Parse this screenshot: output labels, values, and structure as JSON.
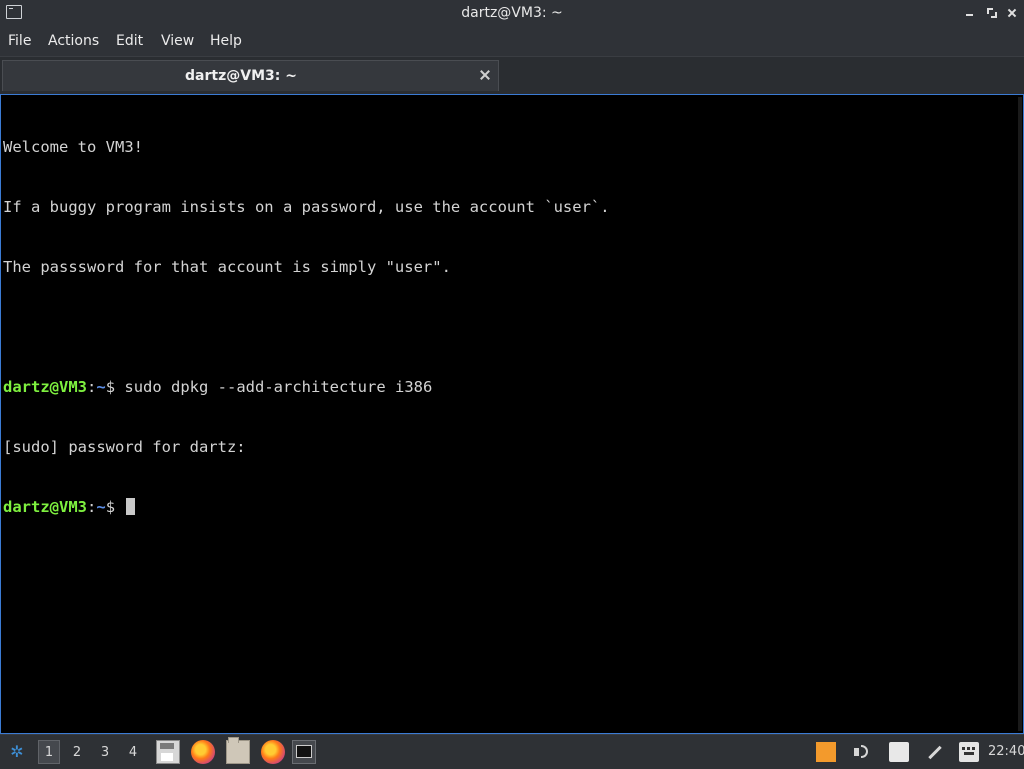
{
  "window": {
    "title": "dartz@VM3: ~"
  },
  "menu": [
    "File",
    "Actions",
    "Edit",
    "View",
    "Help"
  ],
  "tab": {
    "label": "dartz@VM3: ~"
  },
  "terminal": {
    "lines": [
      "Welcome to VM3!",
      "If a buggy program insists on a password, use the account `user`.",
      "The passsword for that account is simply \"user\".",
      ""
    ],
    "prompt_user": "dartz@VM3",
    "prompt_sep": ":",
    "prompt_path": "~",
    "prompt_symbol": "$ ",
    "command": "sudo dpkg --add-architecture i386",
    "sudo_line": "[sudo] password for dartz:"
  },
  "taskbar": {
    "workspaces": [
      "1",
      "2",
      "3",
      "4"
    ],
    "active_workspace": "1",
    "apps": [
      "save-icon",
      "firefox-icon",
      "file-manager-icon",
      "firefox-icon",
      "terminal-icon"
    ],
    "tray": [
      "color-picker-icon",
      "volume-icon",
      "clipboard-icon",
      "pen-icon",
      "keyboard-icon"
    ],
    "clock": "22:40"
  },
  "colors": {
    "prompt_user": "#7ef03f",
    "prompt_path": "#5c8fe8",
    "terminal_bg": "#000000",
    "accent_border": "#3b7bd4"
  }
}
